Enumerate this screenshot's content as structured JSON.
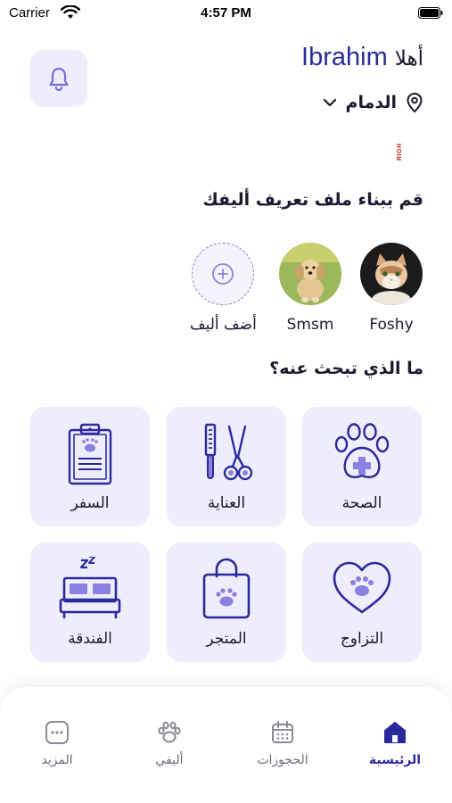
{
  "status_bar": {
    "carrier": "Carrier",
    "time": "4:57 PM"
  },
  "header": {
    "greeting_hello": "أهلا",
    "user_name": "Ibrahim",
    "city": "الدمام",
    "logo_text": "RIGH"
  },
  "pets_section": {
    "title": "قم ببناء ملف تعريف أليفك",
    "pets": [
      {
        "name": "Foshy"
      },
      {
        "name": "Smsm"
      }
    ],
    "add_label": "أضف أليف"
  },
  "services_section": {
    "title": "ما الذي تبحث عنه؟",
    "items": [
      {
        "label": "الصحة",
        "icon": "paw-medical-icon"
      },
      {
        "label": "العناية",
        "icon": "grooming-tools-icon"
      },
      {
        "label": "السفر",
        "icon": "clipboard-icon"
      },
      {
        "label": "التزاوج",
        "icon": "heart-paw-icon"
      },
      {
        "label": "المتجر",
        "icon": "shopping-bag-icon"
      },
      {
        "label": "الفندقة",
        "icon": "bed-icon"
      }
    ]
  },
  "tabbar": {
    "items": [
      {
        "label": "الرئيسية",
        "icon": "home-icon",
        "active": true
      },
      {
        "label": "الحجوزات",
        "icon": "calendar-icon",
        "active": false
      },
      {
        "label": "أليفي",
        "icon": "paw-icon",
        "active": false
      },
      {
        "label": "المزيد",
        "icon": "more-icon",
        "active": false
      }
    ]
  },
  "colors": {
    "primary": "#2b2a9c",
    "accent": "#7b6ee0",
    "tile_bg": "#eeedfb",
    "text": "#1a1a2e"
  }
}
